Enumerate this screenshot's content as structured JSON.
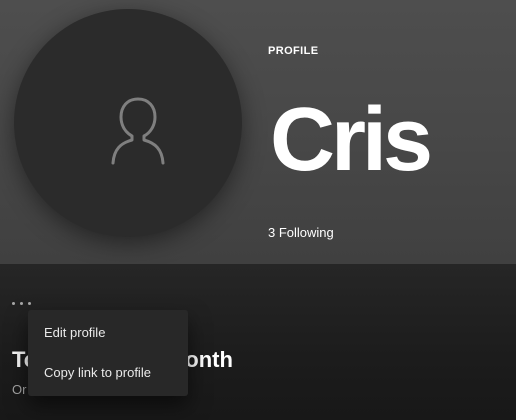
{
  "header": {
    "label": "PROFILE",
    "name": "Cris",
    "following": "3 Following"
  },
  "avatar": {
    "icon": "user-silhouette-icon"
  },
  "actions": {
    "more_icon": "more-options-icon"
  },
  "section": {
    "title": "To",
    "title_tail": "onth",
    "subtitle": "Or"
  },
  "context_menu": {
    "items": [
      {
        "label": "Edit profile"
      },
      {
        "label": "Copy link to profile"
      }
    ]
  },
  "colors": {
    "header_bg": "#4e4e4e",
    "avatar_bg": "#2b2b2b",
    "menu_bg": "#282828",
    "muted_text": "#a7a7a7"
  }
}
